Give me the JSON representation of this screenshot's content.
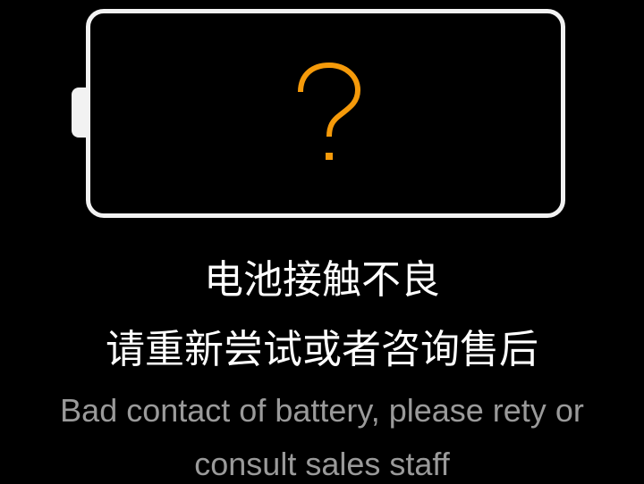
{
  "battery": {
    "status_icon": "question-mark-icon",
    "icon_color": "#f59a0a",
    "outline_color": "#f2f2f2"
  },
  "message": {
    "title_cn": "电池接触不良",
    "subtitle_cn": "请重新尝试或者咨询售后",
    "text_en": "Bad contact of battery, please rety or consult sales staff"
  }
}
